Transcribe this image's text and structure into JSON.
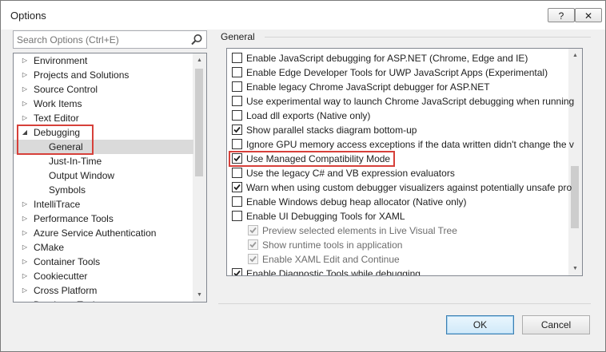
{
  "window": {
    "title": "Options",
    "help_button": "?",
    "close_button": "✕"
  },
  "search": {
    "placeholder": "Search Options (Ctrl+E)"
  },
  "tree": {
    "items": [
      {
        "label": "Environment",
        "level": 0,
        "expander": "collapsed"
      },
      {
        "label": "Projects and Solutions",
        "level": 0,
        "expander": "collapsed"
      },
      {
        "label": "Source Control",
        "level": 0,
        "expander": "collapsed"
      },
      {
        "label": "Work Items",
        "level": 0,
        "expander": "collapsed"
      },
      {
        "label": "Text Editor",
        "level": 0,
        "expander": "collapsed"
      },
      {
        "label": "Debugging",
        "level": 0,
        "expander": "expanded"
      },
      {
        "label": "General",
        "level": 1,
        "expander": "none",
        "selected": true
      },
      {
        "label": "Just-In-Time",
        "level": 1,
        "expander": "none"
      },
      {
        "label": "Output Window",
        "level": 1,
        "expander": "none"
      },
      {
        "label": "Symbols",
        "level": 1,
        "expander": "none"
      },
      {
        "label": "IntelliTrace",
        "level": 0,
        "expander": "collapsed"
      },
      {
        "label": "Performance Tools",
        "level": 0,
        "expander": "collapsed"
      },
      {
        "label": "Azure Service Authentication",
        "level": 0,
        "expander": "collapsed"
      },
      {
        "label": "CMake",
        "level": 0,
        "expander": "collapsed"
      },
      {
        "label": "Container Tools",
        "level": 0,
        "expander": "collapsed"
      },
      {
        "label": "Cookiecutter",
        "level": 0,
        "expander": "collapsed"
      },
      {
        "label": "Cross Platform",
        "level": 0,
        "expander": "collapsed"
      },
      {
        "label": "Database Tools",
        "level": 0,
        "expander": "collapsed"
      }
    ]
  },
  "section": {
    "title": "General"
  },
  "options": [
    {
      "label": "Enable JavaScript debugging for ASP.NET (Chrome, Edge and IE)",
      "checked": false,
      "disabled": false,
      "indent": 0
    },
    {
      "label": "Enable Edge Developer Tools for UWP JavaScript Apps (Experimental)",
      "checked": false,
      "disabled": false,
      "indent": 0
    },
    {
      "label": "Enable legacy Chrome JavaScript debugger for ASP.NET",
      "checked": false,
      "disabled": false,
      "indent": 0
    },
    {
      "label": "Use experimental way to launch Chrome JavaScript debugging when running",
      "checked": false,
      "disabled": false,
      "indent": 0
    },
    {
      "label": "Load dll exports (Native only)",
      "checked": false,
      "disabled": false,
      "indent": 0
    },
    {
      "label": "Show parallel stacks diagram bottom-up",
      "checked": true,
      "disabled": false,
      "indent": 0
    },
    {
      "label": "Ignore GPU memory access exceptions if the data written didn't change the v",
      "checked": false,
      "disabled": false,
      "indent": 0
    },
    {
      "label": "Use Managed Compatibility Mode",
      "checked": true,
      "disabled": false,
      "indent": 0,
      "highlighted": true
    },
    {
      "label": "Use the legacy C# and VB expression evaluators",
      "checked": false,
      "disabled": false,
      "indent": 0
    },
    {
      "label": "Warn when using custom debugger visualizers against potentially unsafe pro",
      "checked": true,
      "disabled": false,
      "indent": 0
    },
    {
      "label": "Enable Windows debug heap allocator (Native only)",
      "checked": false,
      "disabled": false,
      "indent": 0
    },
    {
      "label": "Enable UI Debugging Tools for XAML",
      "checked": false,
      "disabled": false,
      "indent": 0
    },
    {
      "label": "Preview selected elements in Live Visual Tree",
      "checked": true,
      "disabled": true,
      "indent": 1
    },
    {
      "label": "Show runtime tools in application",
      "checked": true,
      "disabled": true,
      "indent": 1
    },
    {
      "label": "Enable XAML Edit and Continue",
      "checked": true,
      "disabled": true,
      "indent": 1
    },
    {
      "label": "Enable Diagnostic Tools while debugging",
      "checked": true,
      "disabled": false,
      "indent": 0
    }
  ],
  "buttons": {
    "ok": "OK",
    "cancel": "Cancel"
  },
  "colors": {
    "highlight_border": "#d6403a",
    "selected_row": "#dadada",
    "default_button_border": "#3c7fb1"
  }
}
